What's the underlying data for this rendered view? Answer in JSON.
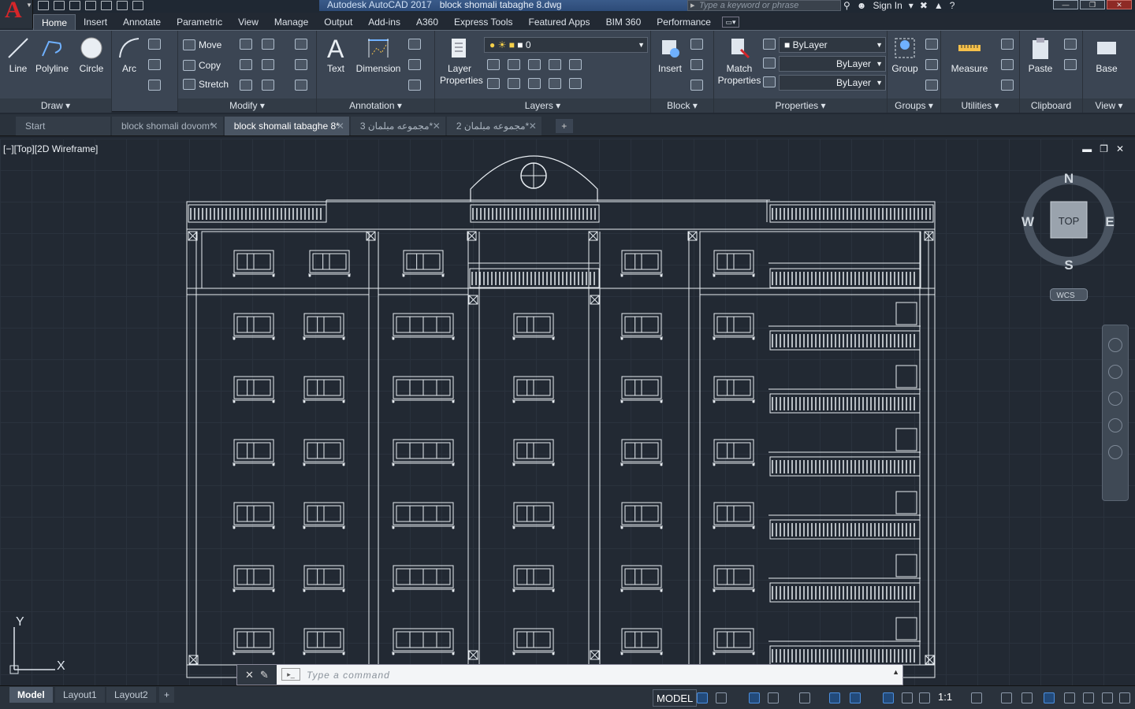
{
  "app": {
    "logo": "A",
    "window_title": "Autodesk AutoCAD 2017",
    "file_title": "block shomali tabaghe 8.dwg",
    "search_placeholder": "Type a keyword or phrase",
    "sign_in": "Sign In"
  },
  "ribbon_tabs": [
    "Home",
    "Insert",
    "Annotate",
    "Parametric",
    "View",
    "Manage",
    "Output",
    "Add-ins",
    "A360",
    "Express Tools",
    "Featured Apps",
    "BIM 360",
    "Performance"
  ],
  "panels": {
    "draw": {
      "title": "Draw",
      "line": "Line",
      "polyline": "Polyline",
      "circle": "Circle",
      "arc": "Arc"
    },
    "modify": {
      "title": "Modify",
      "move": "Move",
      "copy": "Copy",
      "stretch": "Stretch"
    },
    "annotation": {
      "title": "Annotation",
      "text": "Text",
      "dimension": "Dimension"
    },
    "layers": {
      "title": "Layers",
      "layer_properties_l1": "Layer",
      "layer_properties_l2": "Properties",
      "current_layer": "0"
    },
    "block": {
      "title": "Block",
      "insert": "Insert"
    },
    "properties": {
      "title": "Properties",
      "match_l1": "Match",
      "match_l2": "Properties",
      "color": "ByLayer",
      "linetype": "ByLayer",
      "lineweight": "ByLayer"
    },
    "groups": {
      "title": "Groups",
      "group": "Group"
    },
    "utilities": {
      "title": "Utilities",
      "measure": "Measure"
    },
    "clipboard": {
      "title": "Clipboard",
      "paste": "Paste"
    },
    "view": {
      "title": "View",
      "base": "Base"
    }
  },
  "doc_tabs": [
    {
      "label": "Start",
      "active": false
    },
    {
      "label": "block shomali dovom*",
      "active": false
    },
    {
      "label": "block shomali tabaghe 8*",
      "active": true
    },
    {
      "label": "3 مجموعه مبلمان*",
      "active": false
    },
    {
      "label": "2 مجموعه مبلمان*",
      "active": false
    }
  ],
  "viewport": {
    "label": "[−][Top][2D Wireframe]",
    "viewcube": {
      "top": "TOP",
      "n": "N",
      "s": "S",
      "e": "E",
      "w": "W",
      "wcs": "WCS"
    },
    "ucs_x": "X",
    "ucs_y": "Y"
  },
  "command": {
    "placeholder": "Type a command"
  },
  "layout_tabs": [
    "Model",
    "Layout1",
    "Layout2"
  ],
  "status": {
    "model": "MODEL",
    "scale": "1:1"
  },
  "drawing": {
    "floors": 7,
    "windows_per_floor": 8,
    "balcony_count": 6
  }
}
